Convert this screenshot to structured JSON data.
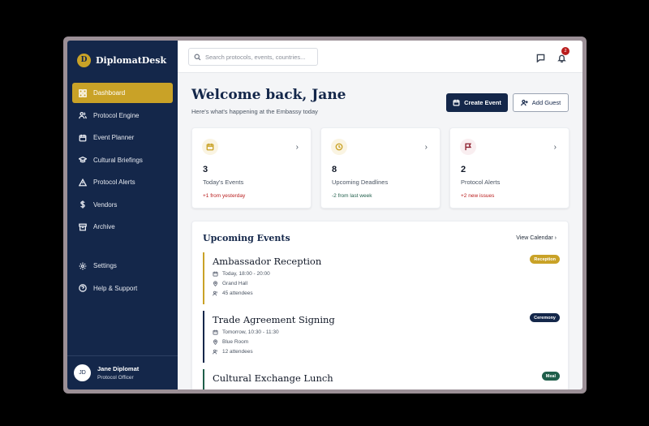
{
  "brand": {
    "logo_letter": "D",
    "name": "DiplomatDesk"
  },
  "sidebar": {
    "items": [
      {
        "label": "Dashboard",
        "icon": "grid-icon",
        "active": true
      },
      {
        "label": "Protocol Engine",
        "icon": "users-icon"
      },
      {
        "label": "Event Planner",
        "icon": "calendar-icon"
      },
      {
        "label": "Cultural Briefings",
        "icon": "graduation-cap-icon"
      },
      {
        "label": "Protocol Alerts",
        "icon": "alert-triangle-icon"
      },
      {
        "label": "Vendors",
        "icon": "dollar-icon"
      },
      {
        "label": "Archive",
        "icon": "archive-icon"
      }
    ],
    "bottom_items": [
      {
        "label": "Settings",
        "icon": "gear-icon"
      },
      {
        "label": "Help & Support",
        "icon": "help-circle-icon"
      }
    ],
    "user": {
      "initials": "JD",
      "name": "Jane Diplomat",
      "role": "Protocol Officer"
    }
  },
  "topbar": {
    "search_placeholder": "Search protocols, events, countries...",
    "notification_count": "2"
  },
  "header": {
    "title": "Welcome back, Jane",
    "subtitle": "Here's what's happening at the Embassy today",
    "create_label": "Create Event",
    "add_guest_label": "Add Guest"
  },
  "stats": [
    {
      "value": "3",
      "label": "Today's Events",
      "change": "+1 from yesterday",
      "change_color": "#b91c1c",
      "icon": "calendar-icon",
      "icon_color": "#c9a227"
    },
    {
      "value": "8",
      "label": "Upcoming Deadlines",
      "change": "-2 from last week",
      "change_color": "#1f5e4a",
      "icon": "clock-icon",
      "icon_color": "#c9a227"
    },
    {
      "value": "2",
      "label": "Protocol Alerts",
      "change": "+2 new issues",
      "change_color": "#b91c1c",
      "icon": "flag-icon",
      "icon_color": "#8b1d2c"
    }
  ],
  "events": {
    "title": "Upcoming Events",
    "view_label": "View Calendar",
    "items": [
      {
        "title": "Ambassador Reception",
        "time": "Today, 18:00 - 20:00",
        "location": "Grand Hall",
        "attendees": "45 attendees",
        "tag": "Reception",
        "color": "#c9a227"
      },
      {
        "title": "Trade Agreement Signing",
        "time": "Tomorrow, 10:30 - 11:30",
        "location": "Blue Room",
        "attendees": "12 attendees",
        "tag": "Ceremony",
        "color": "#14274a"
      },
      {
        "title": "Cultural Exchange Lunch",
        "time": "",
        "location": "",
        "attendees": "",
        "tag": "Meal",
        "color": "#1f5e4a"
      }
    ]
  }
}
